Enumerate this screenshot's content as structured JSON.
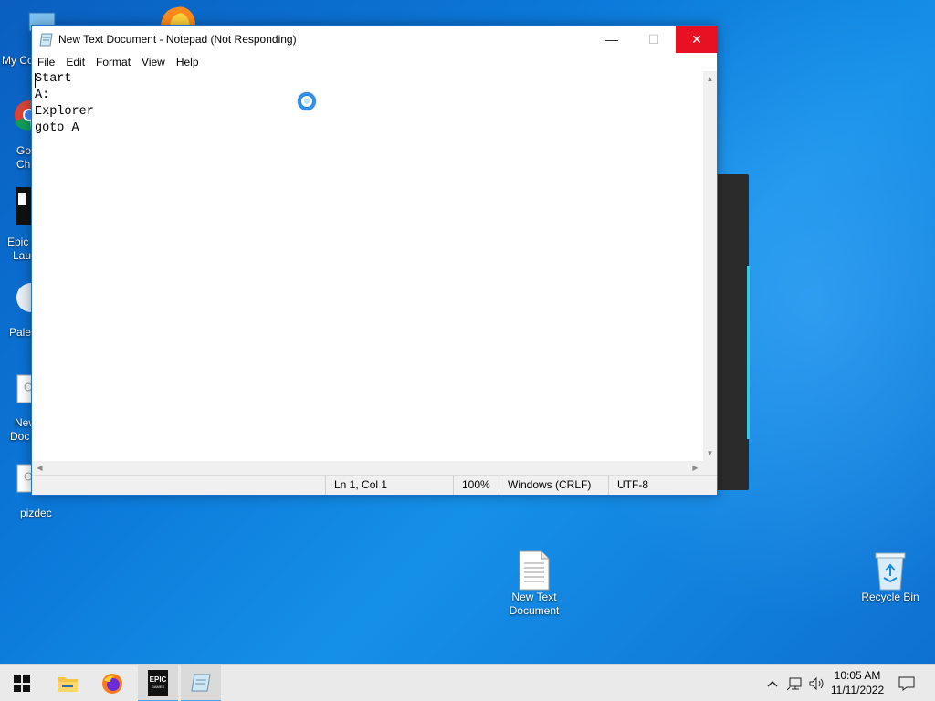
{
  "notepad": {
    "title": "New Text Document - Notepad (Not Responding)",
    "menu": [
      "File",
      "Edit",
      "Format",
      "View",
      "Help"
    ],
    "lines": [
      "Start",
      "A:",
      "Explorer",
      "goto A"
    ],
    "status": {
      "position": "Ln 1, Col 1",
      "zoom": "100%",
      "line_ending": "Windows (CRLF)",
      "encoding": "UTF-8"
    },
    "controls": {
      "minimize": "—",
      "maximize": "☐",
      "close": "✕"
    }
  },
  "desktop": {
    "left_labels": [
      "My Co",
      "Go",
      "Ch",
      "Epic",
      "Lau",
      "Pale",
      "New",
      "Doc",
      "pizdec"
    ],
    "icons": {
      "new_text_document": "New Text Document",
      "recycle_bin": "Recycle Bin"
    }
  },
  "taskbar": {
    "clock_time": "10:05 AM",
    "clock_date": "11/11/2022",
    "epic_label": "EPIC",
    "epic_sub": "GAMES"
  },
  "colors": {
    "accent": "#0b78d8",
    "close_red": "#e81123",
    "taskbar": "#eaeaea"
  }
}
